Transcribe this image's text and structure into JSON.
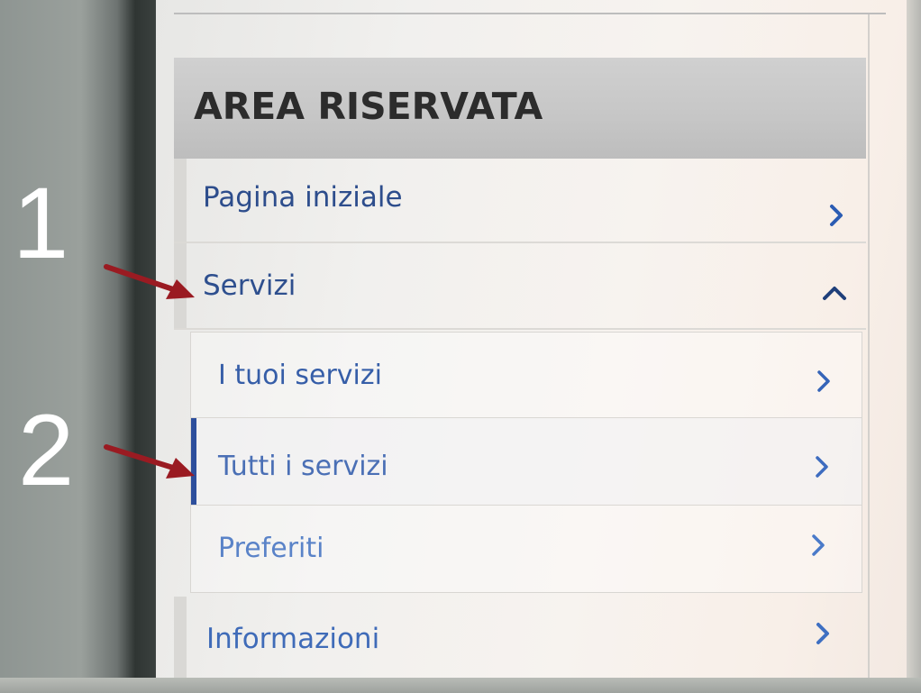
{
  "menu": {
    "title": "AREA RISERVATA",
    "items": {
      "home": {
        "label": "Pagina iniziale"
      },
      "servizi": {
        "label": "Servizi",
        "expanded": true
      },
      "info": {
        "label": "Informazioni"
      }
    },
    "submenu": [
      {
        "label": "I tuoi servizi"
      },
      {
        "label": "Tutti i servizi",
        "active": true
      },
      {
        "label": "Preferiti"
      }
    ]
  },
  "annotations": {
    "step1": "1",
    "step2": "2",
    "arrow_color": "#9a1b22"
  },
  "colors": {
    "link": "#3a62ad",
    "active_bar": "#2d4f9c",
    "header_bg": "#c8c8c8",
    "header_text": "#2c2c2c"
  },
  "icons": {
    "chevron_right": "chevron-right-icon",
    "chevron_up": "chevron-up-icon",
    "arrow": "arrow-annotation"
  }
}
